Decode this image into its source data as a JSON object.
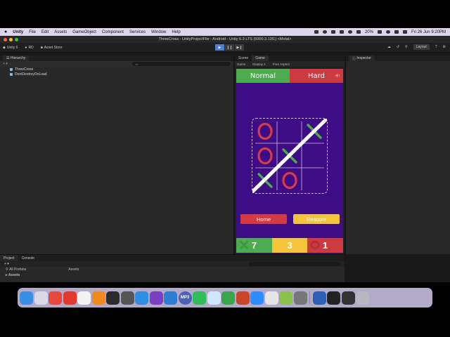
{
  "menubar": {
    "apple_icon": "apple-icon",
    "app_name": "Unity",
    "items": [
      "File",
      "Edit",
      "Assets",
      "GameObject",
      "Component",
      "Services",
      "Window",
      "Help"
    ],
    "battery": "20%",
    "clock": "Fri 26 Jun  9:20PM"
  },
  "editor": {
    "window_title": "ThreeCross - UnityProjectFile - Android - Unity 6.3 LTS (6000.3.13f1) <Metal>",
    "toolbar": {
      "account": "Unity 6",
      "rd": "RD",
      "asset_store": "Asset Store",
      "layout": "Layout"
    },
    "hierarchy": {
      "tab": "Hierarchy",
      "search_placeholder": "All",
      "items": [
        "ThreeCross",
        "DontDestroyOnLoad"
      ]
    },
    "scene_tabs": [
      "Scene",
      "Game"
    ],
    "game_bar": [
      "Game",
      "Display 1",
      "Free Aspect"
    ],
    "inspector_tab": "Inspector",
    "project": {
      "tabs": [
        "Project",
        "Console"
      ],
      "all_prefabs": "All Prefabs",
      "assets_header": "Assets",
      "assets_folder": "Assets"
    }
  },
  "game": {
    "mode_normal": "Normal",
    "mode_hard": "Hard",
    "home_button": "Home",
    "rescore_button": "Rescore",
    "board": [
      [
        "O",
        "",
        "X"
      ],
      [
        "O",
        "X",
        ""
      ],
      [
        "X",
        "O",
        ""
      ]
    ],
    "winning_line": "anti-diagonal",
    "scores": {
      "x": "7",
      "draw": "3",
      "o": "1"
    },
    "colors": {
      "background": "#3e0d86",
      "normal": "#4cac4f",
      "hard": "#cc3941",
      "draw": "#f4c53c",
      "x_mark": "#4cac4f",
      "o_mark": "#d63c46"
    }
  },
  "dock": {
    "icons": [
      "finder-icon",
      "launchpad-icon",
      "chrome-icon",
      "anydesk-icon",
      "textedit-icon",
      "vlc-icon",
      "terminal-icon",
      "unity-hub-icon",
      "safari-icon",
      "visual-studio-icon",
      "vscode-icon",
      "mp3-icon",
      "whatsapp-icon",
      "stats-icon",
      "camtasia-icon",
      "powerpoint-icon",
      "zoom-icon",
      "roblox-icon",
      "android-studio-icon",
      "simulator-icon",
      "word-icon",
      "unity-icon",
      "unity-editor-icon",
      "trash-icon"
    ],
    "mp3_label": "MP3"
  }
}
